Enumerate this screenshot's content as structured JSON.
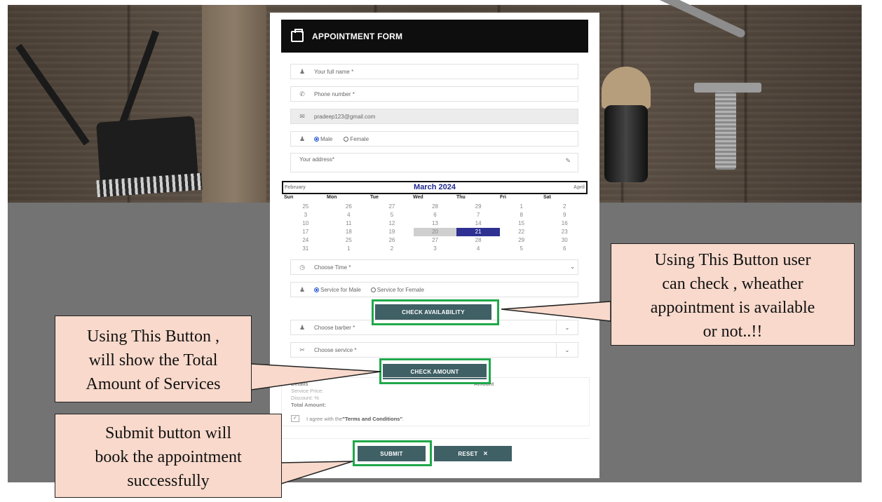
{
  "form": {
    "title": "APPOINTMENT FORM",
    "name_placeholder": "Your full name *",
    "phone_placeholder": "Phone number *",
    "email_value": "pradeep123@gmail.com",
    "gender_male": "Male",
    "gender_female": "Female",
    "address_placeholder": "Your address*",
    "time_placeholder": "Choose Time *",
    "service_male": "Service for Male",
    "service_female": "Service for Female",
    "check_availability": "CHECK AVAILABILITY",
    "barber_placeholder": "Choose barber *",
    "service_placeholder": "Choose service *",
    "check_amount": "CHECK AMOUNT",
    "submit": "SUBMIT",
    "reset": "RESET",
    "reset_icon": "×"
  },
  "calendar": {
    "prev": "February",
    "title": "March 2024",
    "next": "April",
    "days": [
      "Sun",
      "Mon",
      "Tue",
      "Wed",
      "Thu",
      "Fri",
      "Sat"
    ],
    "weeks": [
      [
        "25",
        "26",
        "27",
        "28",
        "29",
        "1",
        "2"
      ],
      [
        "3",
        "4",
        "5",
        "6",
        "7",
        "8",
        "9"
      ],
      [
        "10",
        "11",
        "12",
        "13",
        "14",
        "15",
        "16"
      ],
      [
        "17",
        "18",
        "19",
        "20",
        "21",
        "22",
        "23"
      ],
      [
        "24",
        "25",
        "26",
        "27",
        "28",
        "29",
        "30"
      ],
      [
        "31",
        "1",
        "2",
        "3",
        "4",
        "5",
        "6"
      ]
    ],
    "today": "20",
    "selected": "21"
  },
  "details": {
    "header": "Details",
    "amount_header": "Amount",
    "service_price": "Service Price:",
    "discount": "Discount: %",
    "total": "Total Amount:",
    "terms_prefix": "I agree with the ",
    "terms_link": "\"Terms and Conditions\"",
    "terms_suffix": "."
  },
  "callouts": {
    "availability": [
      "Using This Button user",
      "can check , wheather",
      "appointment is available",
      "or not..!!"
    ],
    "amount": [
      "Using This Button ,",
      "will show the Total",
      "Amount of Services"
    ],
    "submit": [
      "Submit button will",
      "book the appointment",
      "successfully"
    ]
  },
  "colors": {
    "highlight": "#1fa84a",
    "button": "#3f6065",
    "calendar_selected": "#2e3192",
    "callout_bg": "#f8d9cb"
  }
}
